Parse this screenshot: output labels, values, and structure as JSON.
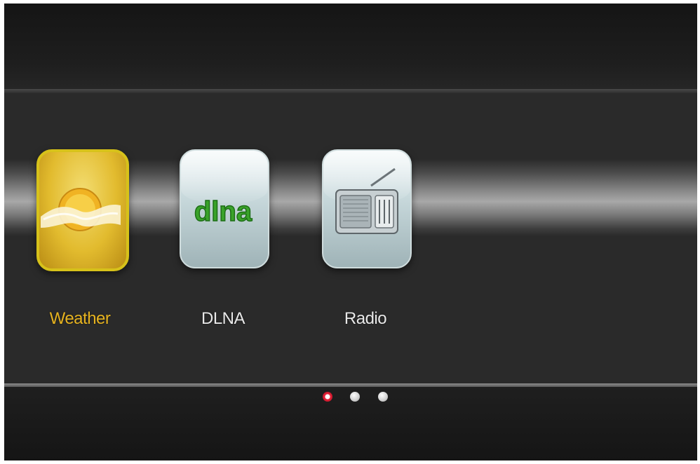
{
  "apps": [
    {
      "label": "Weather",
      "icon": "weather-icon",
      "selected": true
    },
    {
      "label": "DLNA",
      "icon": "dlna-icon",
      "selected": false,
      "logo_text": "dlna"
    },
    {
      "label": "Radio",
      "icon": "radio-icon",
      "selected": false
    }
  ],
  "pager": {
    "pages": 3,
    "current": 1
  },
  "colors": {
    "selected_label": "#e6b320",
    "label": "#e8e8e8",
    "dlna_green": "#3aa32a",
    "active_dot": "#e8233a"
  }
}
